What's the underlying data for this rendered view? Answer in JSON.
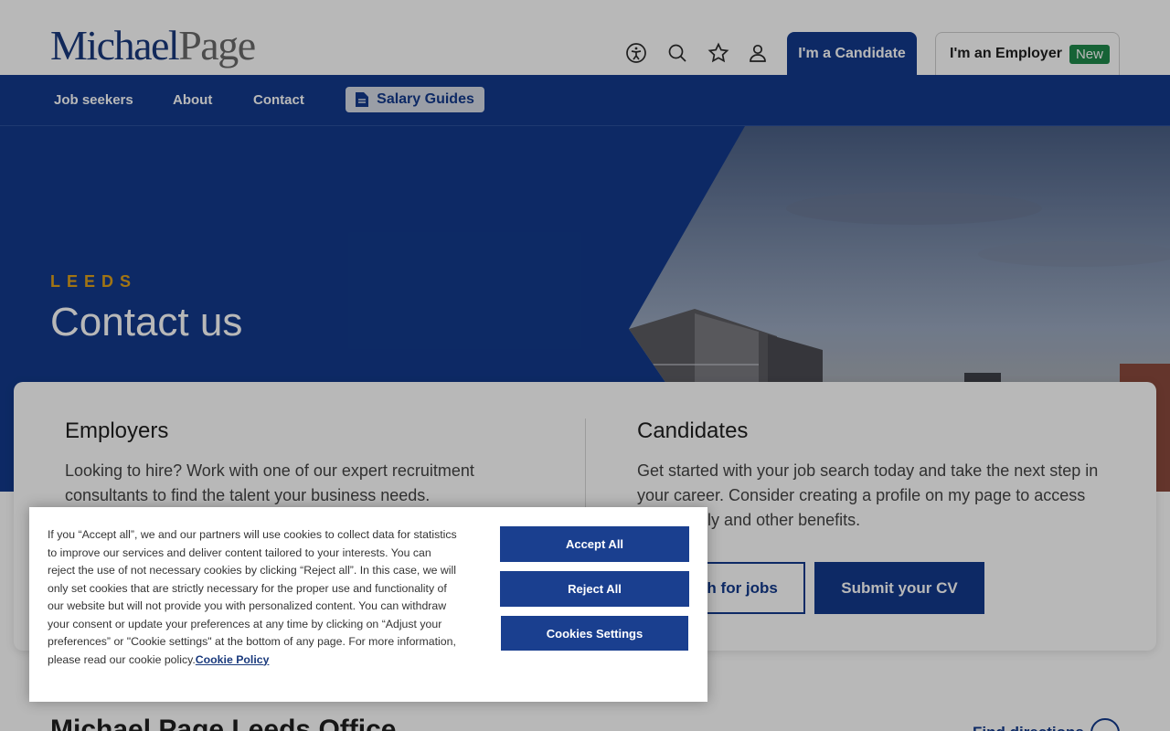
{
  "header": {
    "logo_first": "Michael",
    "logo_second": "Page",
    "icons": [
      "accessibility-icon",
      "search-icon",
      "star-icon",
      "user-icon"
    ],
    "candidate_tab": "I'm a Candidate",
    "employer_tab": "I'm an Employer",
    "employer_badge": "New"
  },
  "nav": {
    "items": [
      {
        "label": "Job seekers"
      },
      {
        "label": "About"
      },
      {
        "label": "Contact"
      }
    ],
    "salary_guides": "Salary Guides"
  },
  "hero": {
    "eyebrow": "LEEDS",
    "title": "Contact us"
  },
  "card": {
    "employers": {
      "title": "Employers",
      "text": "Looking to hire? Work with one of our expert recruitment consultants to find the talent your business needs."
    },
    "candidates": {
      "title": "Candidates",
      "text": "Get started with your job search today and take the next step in your career. Consider creating a profile on my page to access quick apply and other benefits.",
      "search_button": "Search for jobs",
      "submit_button": "Submit your CV"
    }
  },
  "office": {
    "title": "Michael Page Leeds Office",
    "find_directions": "Find directions"
  },
  "cookie": {
    "text": "If you “Accept all”, we and our partners will use cookies to collect data for statistics to improve our services and deliver content tailored to your interests. You can reject the use of not necessary cookies by clicking “Reject all”. In this case, we will only set cookies that are strictly necessary for the proper use and functionality of our website but will not provide you with personalized content. You can withdraw your consent or update your preferences at any time by clicking on “Adjust your preferences” or \"Cookie settings\" at the bottom of any page. For more information, please read our cookie policy.",
    "policy_link": "Cookie Policy",
    "accept": "Accept All",
    "reject": "Reject All",
    "settings": "Cookies Settings"
  },
  "colors": {
    "brand_blue": "#123a8c",
    "accent_gold": "#e0a11b",
    "badge_green": "#1f8a4c"
  }
}
